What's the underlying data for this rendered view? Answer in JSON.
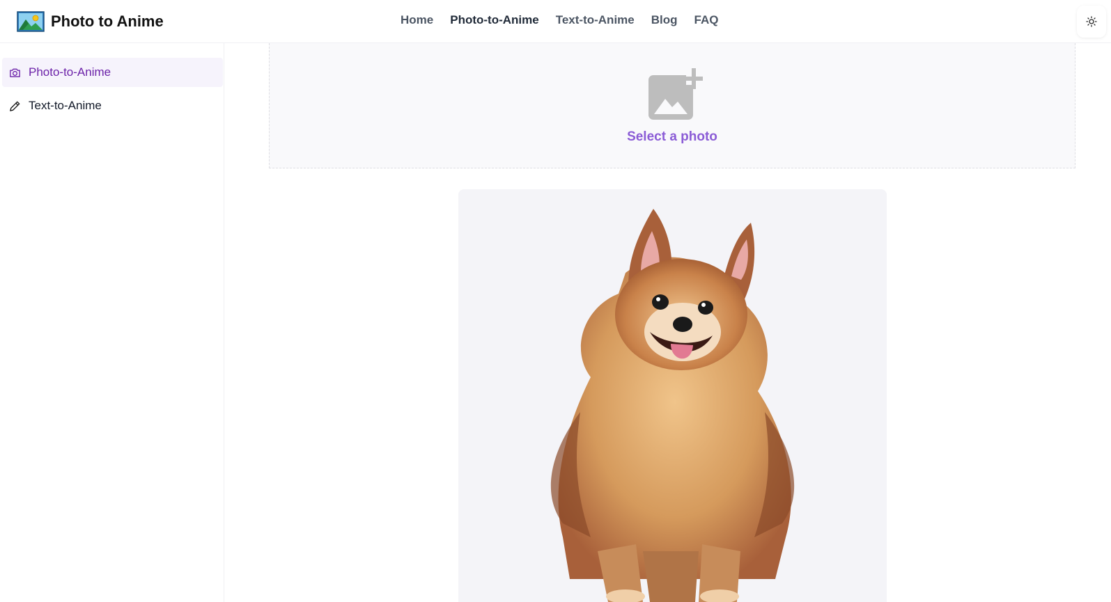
{
  "header": {
    "brand": "Photo to Anime",
    "nav": [
      {
        "label": "Home",
        "active": false
      },
      {
        "label": "Photo-to-Anime",
        "active": true
      },
      {
        "label": "Text-to-Anime",
        "active": false
      },
      {
        "label": "Blog",
        "active": false
      },
      {
        "label": "FAQ",
        "active": false
      }
    ],
    "theme_icon": "sun-icon"
  },
  "sidebar": {
    "items": [
      {
        "label": "Photo-to-Anime",
        "icon": "camera-icon",
        "active": true
      },
      {
        "label": "Text-to-Anime",
        "icon": "pencil-icon",
        "active": false
      }
    ]
  },
  "upload": {
    "label": "Select a photo",
    "icon": "add-photo-icon"
  },
  "result": {
    "image": "anime-dog-image"
  },
  "colors": {
    "accent": "#8b5cd6",
    "sidebar_active_bg": "#f6f3fc",
    "sidebar_active_text": "#6b21a8"
  }
}
